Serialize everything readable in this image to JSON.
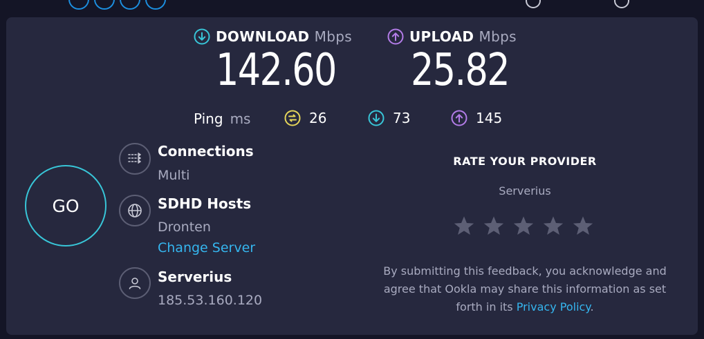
{
  "download": {
    "label": "DOWNLOAD",
    "unit": "Mbps",
    "value": "142.60"
  },
  "upload": {
    "label": "UPLOAD",
    "unit": "Mbps",
    "value": "25.82"
  },
  "ping": {
    "label": "Ping",
    "unit": "ms",
    "idle": "26",
    "download": "73",
    "upload": "145"
  },
  "go_label": "GO",
  "connections": {
    "title": "Connections",
    "value": "Multi"
  },
  "server": {
    "title": "SDHD Hosts",
    "location": "Dronten",
    "change_label": "Change Server"
  },
  "provider": {
    "name": "Serverius",
    "ip": "185.53.160.120"
  },
  "rating": {
    "title": "RATE YOUR PROVIDER",
    "provider": "Serverius",
    "stars": 5,
    "disclaimer_pre": "By submitting this feedback, you acknowledge and agree that Ookla may share this information as set forth in its",
    "privacy_link": "Privacy Policy",
    "disclaimer_post": "."
  },
  "colors": {
    "background": "#141526",
    "card": "#26283e",
    "download_accent": "#38c6d8",
    "upload_accent": "#b37ce8",
    "ping_accent": "#e6d65a",
    "link": "#35b6ef"
  },
  "icons": {
    "download": "download-arrow-icon",
    "upload": "upload-arrow-icon",
    "ping": "ping-icon",
    "connections": "connections-icon",
    "server": "globe-icon",
    "provider": "user-icon",
    "star": "star-icon"
  }
}
